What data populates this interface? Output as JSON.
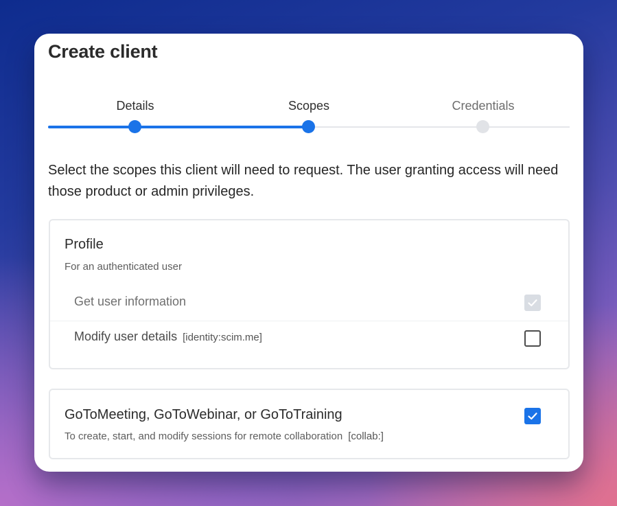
{
  "dialog": {
    "title": "Create client"
  },
  "stepper": {
    "steps": [
      {
        "label": "Details",
        "state": "complete"
      },
      {
        "label": "Scopes",
        "state": "active"
      },
      {
        "label": "Credentials",
        "state": "pending"
      }
    ]
  },
  "intro_text": "Select the scopes this client will need to request. The user granting access will need those product or admin privileges.",
  "profile": {
    "title": "Profile",
    "subtitle": "For an authenticated user",
    "scopes": [
      {
        "label": "Get user information",
        "code": "",
        "checked": true,
        "disabled": true
      },
      {
        "label": "Modify user details",
        "code": "[identity:scim.me]",
        "checked": false,
        "disabled": false
      }
    ]
  },
  "meeting": {
    "title": "GoToMeeting, GoToWebinar, or GoToTraining",
    "subtitle": "To create, start, and modify sessions for remote collaboration",
    "code": "[collab:]",
    "checked": true
  },
  "colors": {
    "accent": "#1a73e8",
    "inactive_dot": "#e1e3e7",
    "disabled_checkbox": "#d9dde3"
  }
}
